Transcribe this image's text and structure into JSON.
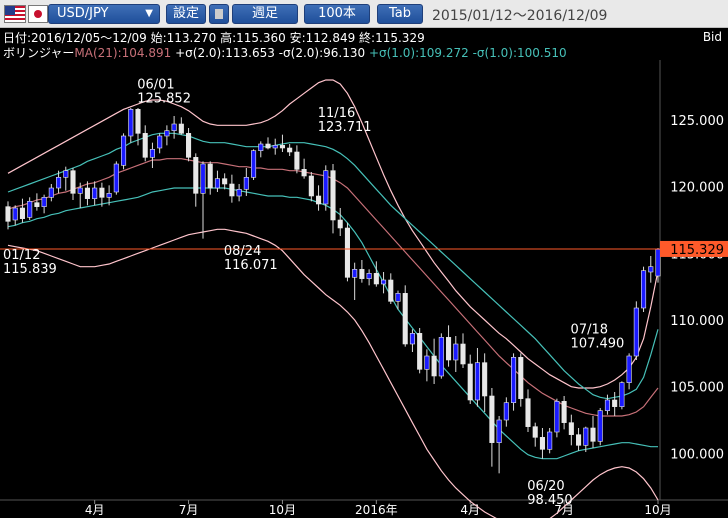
{
  "toolbar": {
    "symbol": "USD/JPY",
    "dropdown_icon": "chevron-down-icon",
    "settings_label": "設定",
    "memo_icon": "square-icon",
    "period_label": "週足",
    "count_label": "100本",
    "tab_label": "Tab",
    "date_range": "2015/01/12～2016/12/09"
  },
  "info": {
    "line1": "日付:2016/12/05～12/09 始:113.270 高:115.360 安:112.849 終:115.329",
    "bb_label": "ボリンジャー",
    "ma": "MA(21):104.891",
    "p2": "+σ(2.0):113.653",
    "m2": "-σ(2.0):96.130",
    "p1": "+σ(1.0):109.272",
    "m1": "-σ(1.0):100.510",
    "bid": "Bid"
  },
  "colors": {
    "up_body": "#1a1aff",
    "down_body": "#e8e8e8",
    "ma": "#c77078",
    "sigma2": "#ffc4cc",
    "sigma1": "#46c0b8",
    "price_line": "#ff5a2a"
  },
  "current_price": "115.329",
  "chart_data": {
    "type": "candlestick",
    "ylim": [
      96.5,
      129.5
    ],
    "y_ticks": [
      "125.000",
      "120.000",
      "115.000",
      "110.000",
      "105.000",
      "100.000"
    ],
    "y_tick_values": [
      125,
      120,
      115,
      110,
      105,
      100
    ],
    "x_ticks": [
      {
        "label": "4月",
        "i": 12
      },
      {
        "label": "7月",
        "i": 25
      },
      {
        "label": "10月",
        "i": 38
      },
      {
        "label": "2016年",
        "i": 51
      },
      {
        "label": "4月",
        "i": 64
      },
      {
        "label": "7月",
        "i": 77
      },
      {
        "label": "10月",
        "i": 90
      }
    ],
    "annotations": [
      {
        "date": "06/01",
        "value": "125.852",
        "i": 19
      },
      {
        "date": "11/16",
        "value": "123.711",
        "i": 44
      },
      {
        "date": "01/12",
        "value": "115.839",
        "i": 0
      },
      {
        "date": "08/24",
        "value": "116.071",
        "i": 31
      },
      {
        "date": "07/18",
        "value": "107.490",
        "i": 79
      },
      {
        "date": "06/20",
        "value": "98.450",
        "i": 73
      }
    ],
    "candles": [
      [
        118.5,
        118.9,
        116.8,
        117.4
      ],
      [
        117.5,
        118.6,
        117.1,
        118.4
      ],
      [
        118.4,
        119.1,
        117.3,
        117.6
      ],
      [
        117.7,
        119.2,
        117.5,
        118.9
      ],
      [
        118.8,
        119.5,
        118.2,
        118.5
      ],
      [
        118.5,
        119.4,
        118.0,
        119.2
      ],
      [
        119.2,
        120.2,
        118.9,
        119.9
      ],
      [
        119.9,
        121.2,
        119.5,
        120.7
      ],
      [
        120.7,
        121.5,
        119.7,
        121.2
      ],
      [
        121.2,
        121.4,
        119.0,
        119.5
      ],
      [
        119.5,
        120.3,
        118.4,
        119.9
      ],
      [
        119.9,
        120.4,
        118.6,
        119.1
      ],
      [
        119.1,
        120.4,
        118.6,
        119.9
      ],
      [
        119.9,
        120.3,
        118.5,
        119.2
      ],
      [
        119.2,
        120.1,
        118.6,
        119.5
      ],
      [
        119.6,
        121.9,
        119.4,
        121.7
      ],
      [
        121.6,
        124.0,
        121.3,
        123.8
      ],
      [
        123.8,
        125.9,
        123.3,
        125.8
      ],
      [
        125.8,
        125.9,
        123.1,
        124.0
      ],
      [
        124.0,
        124.6,
        121.9,
        122.2
      ],
      [
        122.2,
        123.3,
        121.4,
        122.8
      ],
      [
        122.9,
        124.0,
        122.5,
        123.8
      ],
      [
        123.8,
        124.6,
        123.1,
        124.2
      ],
      [
        124.2,
        125.3,
        123.6,
        124.7
      ],
      [
        124.7,
        125.2,
        123.9,
        124.0
      ],
      [
        124.0,
        124.4,
        121.9,
        122.2
      ],
      [
        122.2,
        122.5,
        118.5,
        119.5
      ],
      [
        119.5,
        121.9,
        116.1,
        121.7
      ],
      [
        121.7,
        121.9,
        119.4,
        119.9
      ],
      [
        119.9,
        121.2,
        119.6,
        120.6
      ],
      [
        120.6,
        121.0,
        119.8,
        120.2
      ],
      [
        120.2,
        120.9,
        118.8,
        119.3
      ],
      [
        119.3,
        120.2,
        118.9,
        119.8
      ],
      [
        119.8,
        121.4,
        119.3,
        120.7
      ],
      [
        120.7,
        122.8,
        120.5,
        122.7
      ],
      [
        122.7,
        123.4,
        122.2,
        123.2
      ],
      [
        123.2,
        123.7,
        122.8,
        122.9
      ],
      [
        122.9,
        123.6,
        122.4,
        123.1
      ],
      [
        123.1,
        123.9,
        122.6,
        122.9
      ],
      [
        122.9,
        123.2,
        122.3,
        122.6
      ],
      [
        122.6,
        123.1,
        121.0,
        121.3
      ],
      [
        121.3,
        122.1,
        120.6,
        120.8
      ],
      [
        120.8,
        121.1,
        118.9,
        119.3
      ],
      [
        119.3,
        120.1,
        118.2,
        118.7
      ],
      [
        118.7,
        121.6,
        118.2,
        121.2
      ],
      [
        121.2,
        121.7,
        116.5,
        117.5
      ],
      [
        117.5,
        118.4,
        116.3,
        116.9
      ],
      [
        116.9,
        117.3,
        112.9,
        113.2
      ],
      [
        113.2,
        114.3,
        111.5,
        113.8
      ],
      [
        113.8,
        114.5,
        112.8,
        113.1
      ],
      [
        113.1,
        113.8,
        112.6,
        113.5
      ],
      [
        113.5,
        114.4,
        112.5,
        112.7
      ],
      [
        112.7,
        113.6,
        112.0,
        113.0
      ],
      [
        113.0,
        113.5,
        111.2,
        111.4
      ],
      [
        111.4,
        112.2,
        110.8,
        112.0
      ],
      [
        112.0,
        112.6,
        108.0,
        108.2
      ],
      [
        108.2,
        109.3,
        107.6,
        109.0
      ],
      [
        109.0,
        109.4,
        106.0,
        106.3
      ],
      [
        106.3,
        107.8,
        105.4,
        107.3
      ],
      [
        107.3,
        108.6,
        105.2,
        105.8
      ],
      [
        105.8,
        109.0,
        105.6,
        108.7
      ],
      [
        108.7,
        109.6,
        106.5,
        107.0
      ],
      [
        107.0,
        108.8,
        106.1,
        108.2
      ],
      [
        108.2,
        109.0,
        106.4,
        106.7
      ],
      [
        106.7,
        107.4,
        103.7,
        104.0
      ],
      [
        104.0,
        107.9,
        103.5,
        106.8
      ],
      [
        106.8,
        107.5,
        103.1,
        104.3
      ],
      [
        104.3,
        104.9,
        99.0,
        100.8
      ],
      [
        100.8,
        102.8,
        98.5,
        102.5
      ],
      [
        102.5,
        104.2,
        102.0,
        103.8
      ],
      [
        103.8,
        107.5,
        103.2,
        107.2
      ],
      [
        107.2,
        107.5,
        103.5,
        104.1
      ],
      [
        104.1,
        104.8,
        101.6,
        102.0
      ],
      [
        102.0,
        102.3,
        100.5,
        101.2
      ],
      [
        101.2,
        101.9,
        99.6,
        100.3
      ],
      [
        100.3,
        101.9,
        100.0,
        101.6
      ],
      [
        101.6,
        104.1,
        101.2,
        103.9
      ],
      [
        103.9,
        104.3,
        101.8,
        102.3
      ],
      [
        102.3,
        102.9,
        100.6,
        101.4
      ],
      [
        101.4,
        101.9,
        100.2,
        100.6
      ],
      [
        100.6,
        102.0,
        100.1,
        101.9
      ],
      [
        101.9,
        102.8,
        100.4,
        100.9
      ],
      [
        100.9,
        103.4,
        100.6,
        103.2
      ],
      [
        103.2,
        104.4,
        102.9,
        104.0
      ],
      [
        104.0,
        104.6,
        102.8,
        103.5
      ],
      [
        103.5,
        105.4,
        103.3,
        105.3
      ],
      [
        105.3,
        107.5,
        104.8,
        107.3
      ],
      [
        107.3,
        111.4,
        107.0,
        110.9
      ],
      [
        110.9,
        114.0,
        110.6,
        113.7
      ],
      [
        113.6,
        114.8,
        112.8,
        114.0
      ],
      [
        113.3,
        115.4,
        112.8,
        115.3
      ]
    ],
    "bands": {
      "ma": [
        118.3,
        118.5,
        118.6,
        118.8,
        119.0,
        119.1,
        119.3,
        119.5,
        119.6,
        119.8,
        120.0,
        120.2,
        120.3,
        120.5,
        120.7,
        121.0,
        121.2,
        121.4,
        121.6,
        121.8,
        122.0,
        122.0,
        122.1,
        122.1,
        122.1,
        122.0,
        121.9,
        121.8,
        121.8,
        121.8,
        121.7,
        121.6,
        121.5,
        121.5,
        121.4,
        121.4,
        121.3,
        121.3,
        121.3,
        121.2,
        121.2,
        121.1,
        121.0,
        120.9,
        120.8,
        120.6,
        120.3,
        119.9,
        119.3,
        118.7,
        118.1,
        117.5,
        116.9,
        116.3,
        115.7,
        115.1,
        114.5,
        113.9,
        113.3,
        112.7,
        112.1,
        111.5,
        110.9,
        110.3,
        109.7,
        109.1,
        108.5,
        107.9,
        107.3,
        106.8,
        106.3,
        105.8,
        105.3,
        104.9,
        104.5,
        104.2,
        103.9,
        103.6,
        103.4,
        103.2,
        103.0,
        102.9,
        102.8,
        102.8,
        102.8,
        102.8,
        102.9,
        103.1,
        103.5,
        104.2,
        104.9
      ],
      "p1": [
        119.6,
        119.8,
        120.0,
        120.2,
        120.4,
        120.6,
        120.8,
        121.0,
        121.2,
        121.4,
        121.6,
        121.9,
        122.1,
        122.3,
        122.5,
        122.8,
        123.0,
        123.3,
        123.5,
        123.7,
        123.9,
        124.0,
        124.0,
        124.0,
        123.9,
        123.8,
        123.6,
        123.4,
        123.3,
        123.3,
        123.3,
        123.2,
        123.1,
        123.0,
        123.0,
        123.0,
        123.0,
        123.1,
        123.2,
        123.3,
        123.3,
        123.3,
        123.2,
        123.1,
        123.0,
        122.8,
        122.5,
        122.1,
        121.6,
        121.0,
        120.4,
        119.8,
        119.2,
        118.6,
        118.1,
        117.6,
        117.1,
        116.6,
        116.1,
        115.6,
        115.1,
        114.6,
        114.1,
        113.6,
        113.1,
        112.6,
        112.1,
        111.6,
        111.1,
        110.6,
        110.1,
        109.6,
        109.1,
        108.6,
        108.0,
        107.4,
        106.8,
        106.2,
        105.7,
        105.2,
        104.8,
        104.4,
        104.2,
        104.1,
        104.2,
        104.3,
        104.5,
        104.8,
        105.7,
        107.4,
        109.3
      ],
      "m1": [
        117.0,
        117.1,
        117.3,
        117.4,
        117.6,
        117.7,
        117.9,
        118.0,
        118.2,
        118.3,
        118.4,
        118.5,
        118.6,
        118.7,
        118.8,
        118.9,
        119.0,
        119.1,
        119.2,
        119.4,
        119.6,
        119.7,
        119.8,
        119.9,
        119.9,
        119.9,
        119.9,
        119.9,
        119.9,
        119.9,
        119.9,
        119.8,
        119.7,
        119.6,
        119.5,
        119.4,
        119.3,
        119.3,
        119.3,
        119.2,
        119.2,
        119.1,
        119.0,
        118.8,
        118.6,
        118.3,
        117.9,
        117.3,
        116.6,
        115.8,
        114.8,
        113.8,
        112.8,
        111.8,
        110.8,
        110.1,
        109.4,
        108.7,
        108.0,
        107.3,
        106.6,
        106.0,
        105.4,
        104.8,
        104.2,
        103.6,
        103.0,
        102.4,
        101.8,
        101.3,
        100.8,
        100.3,
        99.9,
        99.7,
        99.6,
        99.6,
        99.6,
        99.8,
        100.0,
        100.2,
        100.3,
        100.4,
        100.5,
        100.6,
        100.7,
        100.8,
        100.8,
        100.7,
        100.6,
        100.5,
        100.5
      ],
      "p2": [
        121.0,
        121.3,
        121.6,
        121.9,
        122.2,
        122.5,
        122.8,
        123.1,
        123.4,
        123.7,
        124.0,
        124.3,
        124.6,
        124.9,
        125.2,
        125.5,
        125.8,
        126.0,
        126.2,
        126.4,
        126.5,
        126.5,
        126.4,
        126.2,
        126.0,
        125.7,
        125.3,
        124.9,
        124.7,
        124.6,
        124.6,
        124.6,
        124.6,
        124.6,
        124.7,
        124.8,
        125.0,
        125.3,
        125.7,
        126.2,
        126.6,
        127.0,
        127.4,
        127.8,
        128.0,
        128.0,
        127.7,
        127.0,
        126.0,
        124.8,
        123.5,
        122.2,
        120.9,
        119.7,
        118.6,
        117.6,
        116.7,
        115.9,
        115.1,
        114.3,
        113.6,
        112.9,
        112.2,
        111.6,
        111.0,
        110.5,
        110.0,
        109.5,
        109.0,
        108.6,
        108.1,
        107.6,
        107.1,
        106.7,
        106.3,
        105.9,
        105.6,
        105.3,
        105.0,
        104.9,
        104.9,
        104.9,
        105.0,
        105.2,
        105.5,
        105.9,
        106.4,
        107.2,
        108.6,
        111.0,
        113.7
      ],
      "m2": [
        115.6,
        115.5,
        115.4,
        115.3,
        115.2,
        115.0,
        114.8,
        114.6,
        114.4,
        114.2,
        114.0,
        114.0,
        114.0,
        114.1,
        114.2,
        114.4,
        114.6,
        114.8,
        115.0,
        115.2,
        115.4,
        115.6,
        115.8,
        116.0,
        116.2,
        116.4,
        116.5,
        116.6,
        116.7,
        116.8,
        116.8,
        116.7,
        116.6,
        116.5,
        116.3,
        116.1,
        115.9,
        115.6,
        115.2,
        114.6,
        114.0,
        113.4,
        112.9,
        112.4,
        111.9,
        111.5,
        111.1,
        110.6,
        110.0,
        109.2,
        108.3,
        107.3,
        106.3,
        105.3,
        104.3,
        103.3,
        102.3,
        101.3,
        100.3,
        99.5,
        98.7,
        98.0,
        97.4,
        96.9,
        96.4,
        96.0,
        95.6,
        95.3,
        95.0,
        94.8,
        94.6,
        94.5,
        94.5,
        94.6,
        94.8,
        95.1,
        95.5,
        96.0,
        96.5,
        97.0,
        97.5,
        98.0,
        98.4,
        98.7,
        98.9,
        99.0,
        98.9,
        98.6,
        98.1,
        97.4,
        96.5
      ]
    }
  }
}
